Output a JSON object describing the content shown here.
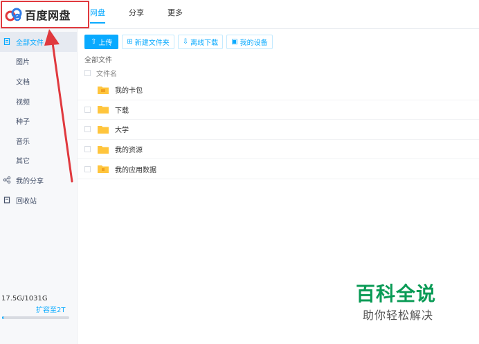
{
  "app": {
    "title": "百度网盘"
  },
  "nav": {
    "tabs": [
      {
        "label": "网盘"
      },
      {
        "label": "分享"
      },
      {
        "label": "更多"
      }
    ]
  },
  "sidebar": {
    "items": [
      {
        "label": "全部文件",
        "icon": "file-icon"
      },
      {
        "label": "图片"
      },
      {
        "label": "文档"
      },
      {
        "label": "视频"
      },
      {
        "label": "种子"
      },
      {
        "label": "音乐"
      },
      {
        "label": "其它"
      },
      {
        "label": "我的分享",
        "icon": "share-icon"
      },
      {
        "label": "回收站",
        "icon": "trash-icon"
      }
    ],
    "storage": {
      "text": "17.5G/1031G",
      "used_fraction": 0.017,
      "expand_label": "扩容至2T"
    }
  },
  "toolbar": {
    "upload_label": "上传",
    "new_folder_label": "新建文件夹",
    "offline_download_label": "离线下载",
    "my_devices_label": "我的设备"
  },
  "breadcrumb": {
    "label": "全部文件"
  },
  "list": {
    "column_name": "文件名",
    "rows": [
      {
        "name": "我的卡包",
        "type": "special-folder"
      },
      {
        "name": "下载",
        "type": "folder"
      },
      {
        "name": "大学",
        "type": "folder"
      },
      {
        "name": "我的资源",
        "type": "folder"
      },
      {
        "name": "我的应用数据",
        "type": "special-folder"
      }
    ]
  },
  "watermark": {
    "main": "百科全说",
    "sub": "助你轻松解决"
  },
  "colors": {
    "accent": "#09aaff",
    "annotation": "#e0393e",
    "folder": "#ffc53d",
    "watermark": "#0a9b56"
  }
}
